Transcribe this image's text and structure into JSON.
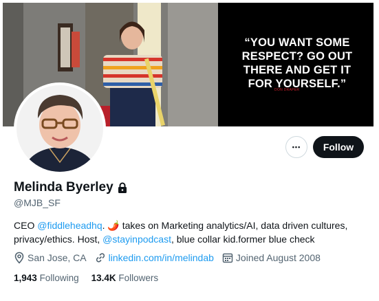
{
  "profile": {
    "display_name": "Melinda Byerley",
    "handle": "@MJB_SF",
    "protected_icon": "lock-icon"
  },
  "banner": {
    "quote_lines": [
      "“YOU WANT SOME",
      "RESPECT? GO OUT",
      "THERE AND GET IT",
      "FOR YOURSELF.”"
    ],
    "quote_author": "DON DRAPER"
  },
  "actions": {
    "more_label": "•••",
    "follow_label": "Follow"
  },
  "bio": {
    "part1": "CEO ",
    "mention1": "@fiddleheadhq",
    "part2": ". 🌶️ takes on Marketing analytics/AI, data driven cultures, privacy/ethics. Host, ",
    "mention2": "@stayinpodcast",
    "part3": ", blue collar kid.former blue check"
  },
  "meta": {
    "location": "San Jose, CA",
    "website": "linkedin.com/in/melindab",
    "joined": "Joined August 2008"
  },
  "stats": {
    "following_count": "1,943",
    "following_label": "Following",
    "followers_count": "13.4K",
    "followers_label": "Followers"
  },
  "colors": {
    "accent": "#1d9bf0",
    "text": "#0f1419",
    "muted": "#536471"
  }
}
